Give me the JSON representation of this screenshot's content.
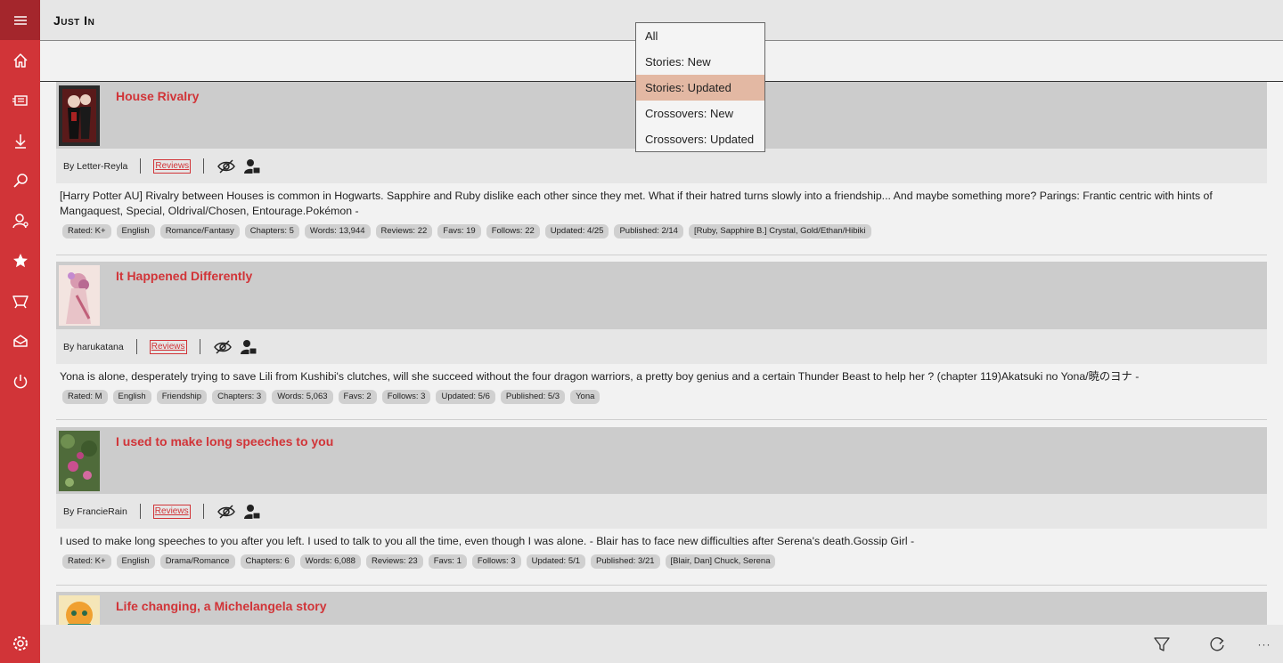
{
  "header": {
    "title": "Just In"
  },
  "filter_menu": {
    "options": [
      "All",
      "Stories: New",
      "Stories: Updated",
      "Crossovers: New",
      "Crossovers: Updated"
    ],
    "selected": "Stories: Updated"
  },
  "sidebar": {
    "icons": [
      "menu-icon",
      "home-icon",
      "news-icon",
      "download-icon",
      "search-icon",
      "user-icon",
      "star-icon",
      "basket-icon",
      "inbox-icon",
      "power-icon",
      "settings-icon"
    ],
    "accent": "#d13438",
    "hamburger_bg": "#a4262c"
  },
  "stories": [
    {
      "title": "House Rivalry",
      "author": "By Letter-Reyla",
      "reviews_label": "Reviews",
      "description": "[Harry Potter AU] Rivalry between Houses is common in Hogwarts. Sapphire and Ruby dislike each other since they met. What if their hatred turns slowly into a friendship... And maybe something more? Parings: Frantic centric with hints of Mangaquest, Special, Oldrival/Chosen, Entourage.Pokémon -",
      "tags": [
        "Rated: K+",
        "English",
        "Romance/Fantasy",
        "Chapters: 5",
        "Words: 13,944",
        "Reviews: 22",
        "Favs: 19",
        "Follows: 22",
        "Updated: 4/25",
        "Published: 2/14",
        "[Ruby, Sapphire B.] Crystal, Gold/Ethan/Hibiki"
      ]
    },
    {
      "title": "It Happened Differently",
      "author": "By harukatana",
      "reviews_label": "Reviews",
      "description": "Yona is alone, desperately trying to save Lili from Kushibi's clutches, will she succeed without the four dragon warriors, a pretty boy genius and a certain Thunder Beast to help her ? (chapter 119)Akatsuki no Yona/暁のヨナ -",
      "tags": [
        "Rated: M",
        "English",
        "Friendship",
        "Chapters: 3",
        "Words: 5,063",
        "Favs: 2",
        "Follows: 3",
        "Updated: 5/6",
        "Published: 5/3",
        "Yona"
      ]
    },
    {
      "title": "I used to make long speeches to you",
      "author": "By FrancieRain",
      "reviews_label": "Reviews",
      "description": "I used to make long speeches to you after you left. I used to talk to you all the time, even though I was alone. - Blair has to face new difficulties after Serena's death.Gossip Girl -",
      "tags": [
        "Rated: K+",
        "English",
        "Drama/Romance",
        "Chapters: 6",
        "Words: 6,088",
        "Reviews: 23",
        "Favs: 1",
        "Follows: 3",
        "Updated: 5/1",
        "Published: 3/21",
        "[Blair, Dan] Chuck, Serena"
      ]
    },
    {
      "title": "Life changing, a Michelangela story"
    }
  ],
  "bottombar": {
    "icons": [
      "filter-icon",
      "refresh-icon",
      "more-icon"
    ],
    "more_label": "···"
  }
}
